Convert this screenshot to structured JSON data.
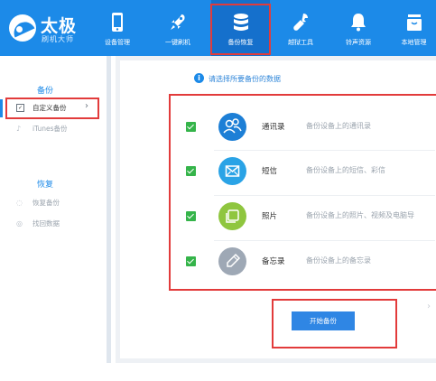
{
  "app": {
    "brand_title": "太极",
    "brand_subtitle": "刷机大师"
  },
  "nav": [
    {
      "label": "设备管理",
      "icon": "phone-icon",
      "active": false
    },
    {
      "label": "一键刷机",
      "icon": "rocket-icon",
      "active": false
    },
    {
      "label": "备份恢复",
      "icon": "database-icon",
      "active": true
    },
    {
      "label": "越狱工具",
      "icon": "wrench-icon",
      "active": false
    },
    {
      "label": "铃声资源",
      "icon": "bell-icon",
      "active": false
    },
    {
      "label": "本地管理",
      "icon": "box-icon",
      "active": false
    }
  ],
  "sidebar": {
    "backup_title": "备份",
    "backup_items": [
      {
        "label": "自定义备份",
        "icon": "checkbox-icon",
        "active": true
      },
      {
        "label": "iTunes备份",
        "icon": "music-note-icon",
        "active": false
      }
    ],
    "restore_title": "恢复",
    "restore_items": [
      {
        "label": "恢复备份",
        "icon": "restore-icon",
        "active": false
      },
      {
        "label": "找回数据",
        "icon": "recover-icon",
        "active": false
      }
    ]
  },
  "main": {
    "hint": "请选择所要备份的数据",
    "hint_icon": "i",
    "options": [
      {
        "name": "通讯录",
        "desc": "备份设备上的通讯录",
        "checked": true,
        "icon": "contacts-icon",
        "color": "#1d7fd6"
      },
      {
        "name": "短信",
        "desc": "备份设备上的短信、彩信",
        "checked": true,
        "icon": "envelope-icon",
        "color": "#2aa3e6"
      },
      {
        "name": "照片",
        "desc": "备份设备上的照片、视频及电脑导",
        "checked": true,
        "icon": "photos-icon",
        "color": "#8fc63f"
      },
      {
        "name": "备忘录",
        "desc": "备份设备上的备忘录",
        "checked": true,
        "icon": "pencil-icon",
        "color": "#9ea8b5"
      }
    ],
    "start_label": "开始备份"
  },
  "colors": {
    "brand_blue": "#1c8ae8",
    "highlight_red": "#e23b3b",
    "check_green": "#35b44a"
  }
}
